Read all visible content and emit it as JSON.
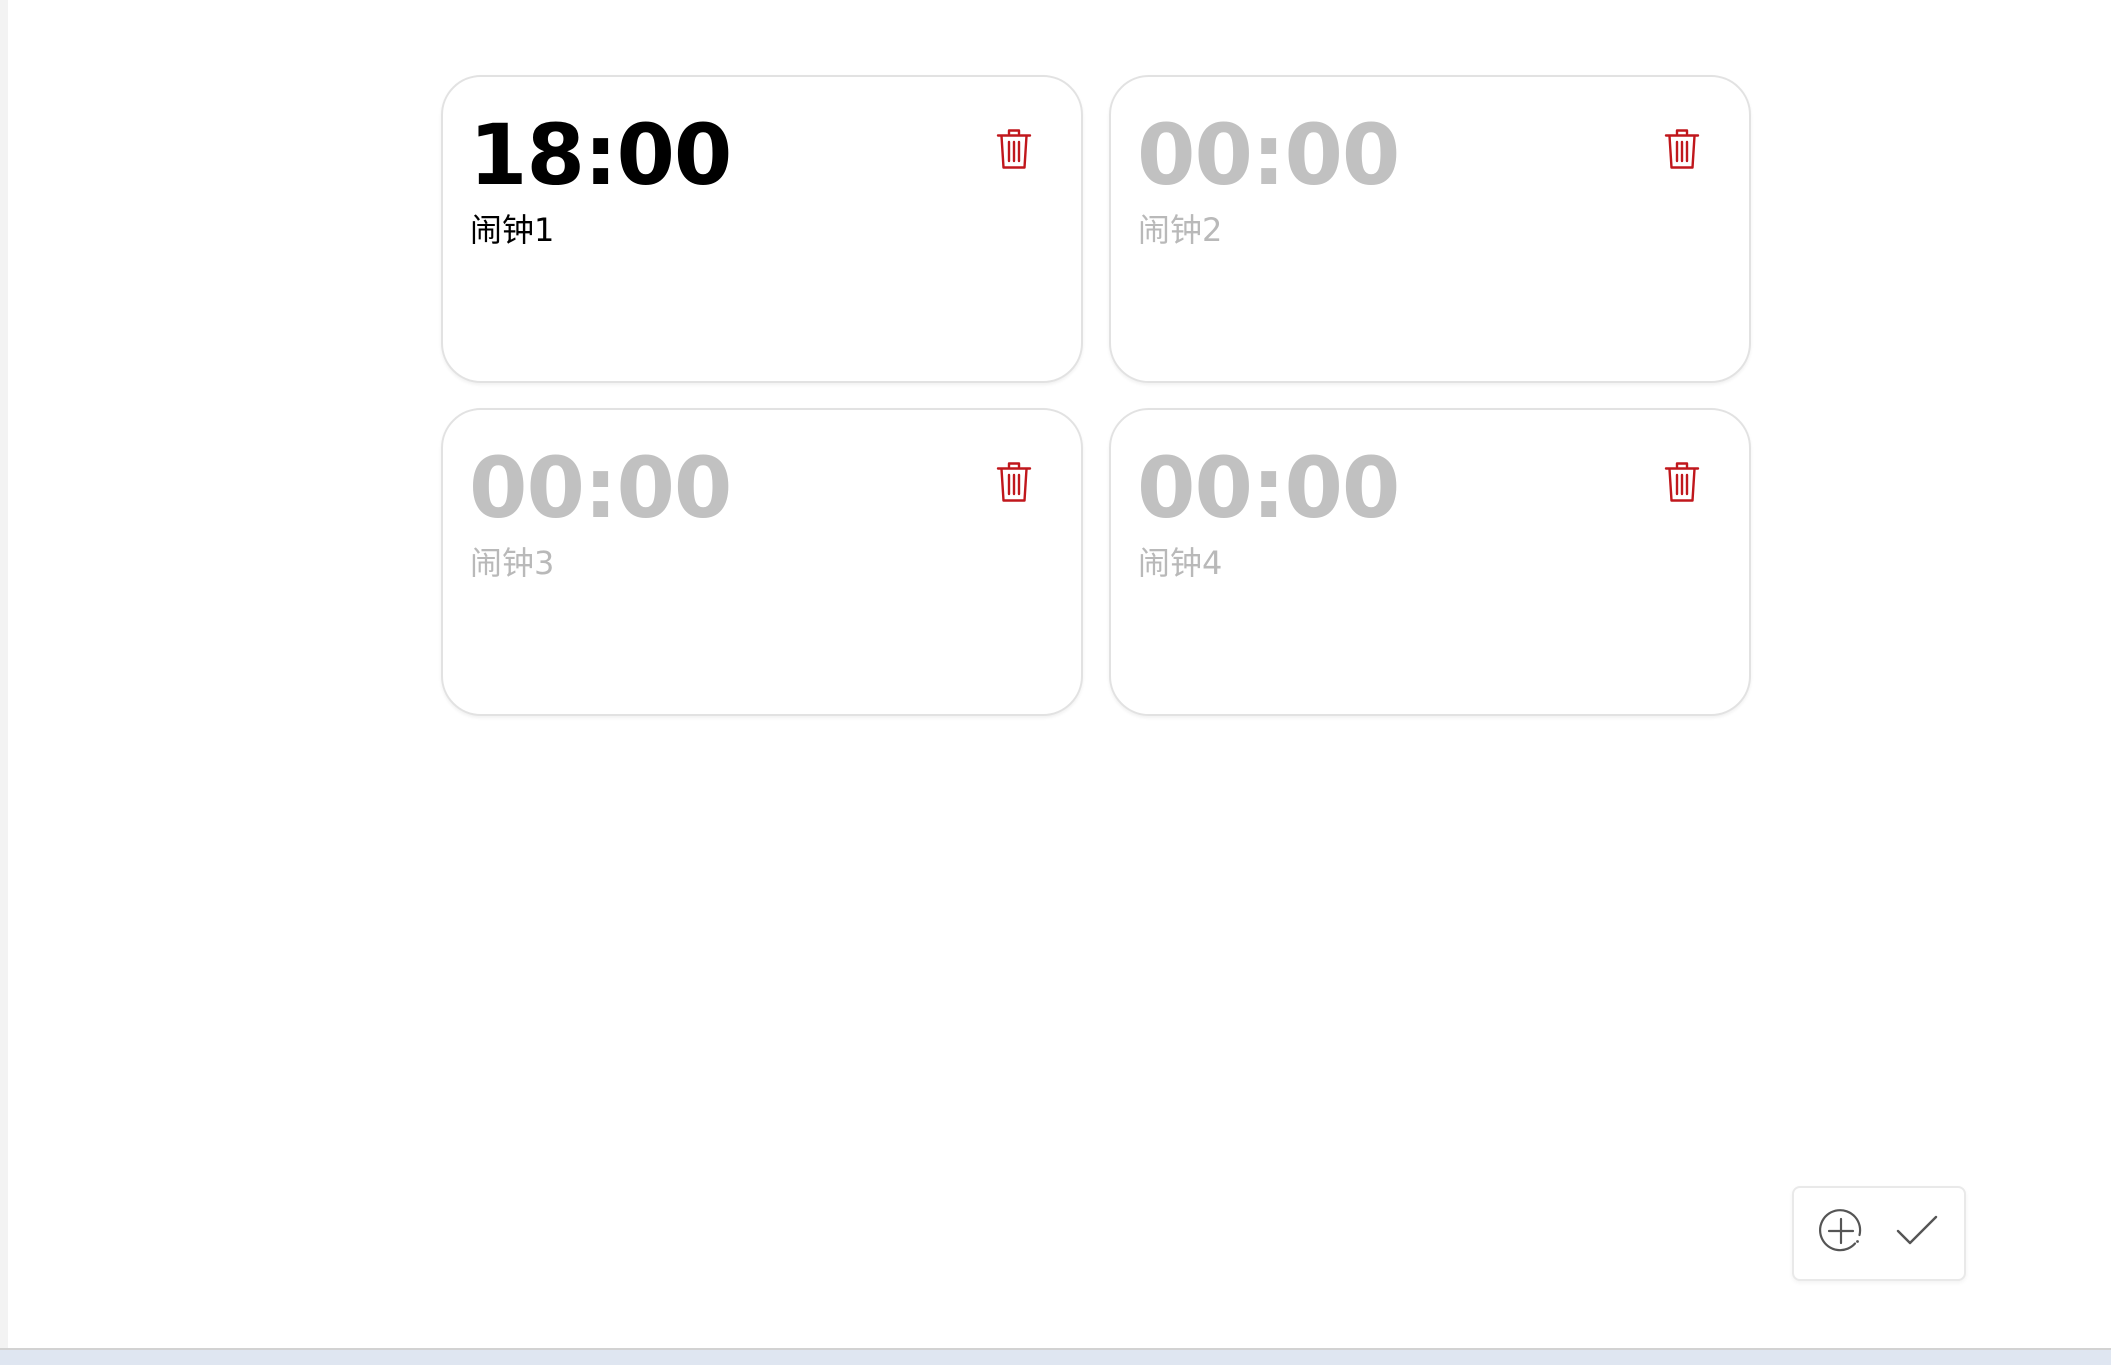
{
  "alarms": [
    {
      "time": "18:00",
      "name": "闹钟1",
      "enabled": true
    },
    {
      "time": "00:00",
      "name": "闹钟2",
      "enabled": false
    },
    {
      "time": "00:00",
      "name": "闹钟3",
      "enabled": false
    },
    {
      "time": "00:00",
      "name": "闹钟4",
      "enabled": false
    }
  ],
  "icons": {
    "delete": "trash-icon",
    "add": "plus-circle-icon",
    "confirm": "check-icon"
  },
  "colors": {
    "delete_icon": "#c0171c",
    "enabled_text": "#000000",
    "disabled_text": "#c1c1c1",
    "action_icon": "#555555"
  }
}
